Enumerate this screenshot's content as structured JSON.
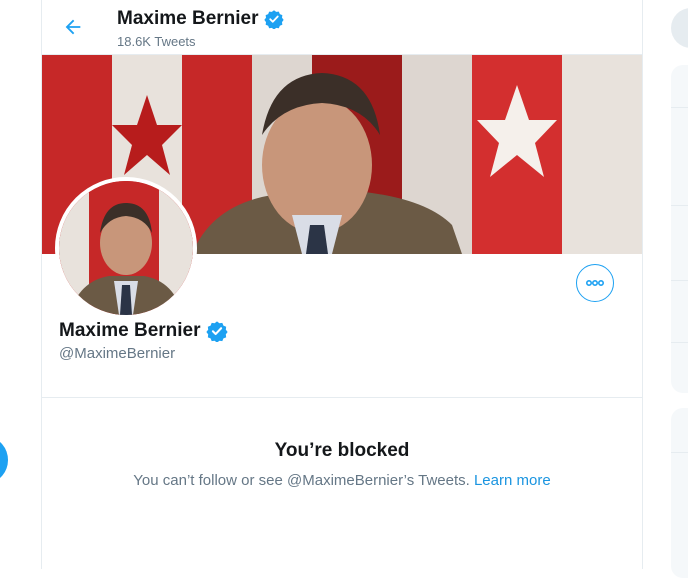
{
  "header": {
    "title": "Maxime Bernier",
    "tweet_count": "18.6K Tweets"
  },
  "profile": {
    "name": "Maxime Bernier",
    "handle": "@MaximeBernier",
    "verified": true
  },
  "blocked": {
    "title": "You’re blocked",
    "message": "You can’t follow or see @MaximeBernier’s Tweets.",
    "link_label": "Learn more"
  },
  "icons": {
    "back": "arrow-left-icon",
    "verified": "verified-badge-icon",
    "more": "more-horizontal-icon"
  },
  "colors": {
    "accent": "#1da1f2",
    "text_primary": "#14171a",
    "text_secondary": "#657786",
    "link": "#1b95e0"
  }
}
